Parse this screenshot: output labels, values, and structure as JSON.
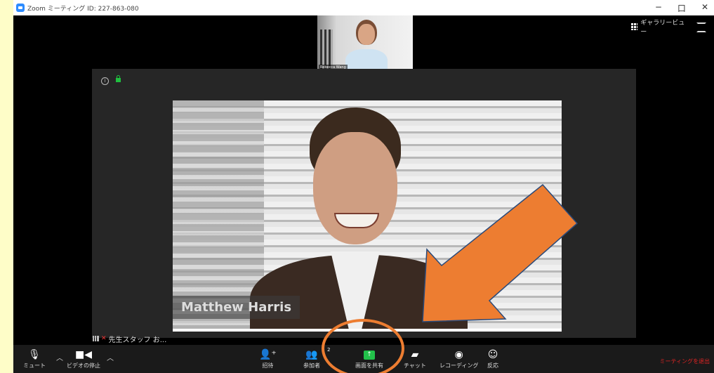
{
  "window": {
    "title": "Zoom ミーティング ID: 227-863-080"
  },
  "title_controls": {
    "minimize": "−",
    "maximize": "口",
    "close": "✕"
  },
  "view": {
    "gallery_label": "ギャラリービュー"
  },
  "thumbnail": {
    "name": "Rebecca Wang"
  },
  "speaker": {
    "name": "Matthew Harris"
  },
  "status": {
    "text": "先生スタッフ お..."
  },
  "toolbar": {
    "mute": "ミュート",
    "video": "ビデオの停止",
    "invite": "招待",
    "participants": "参加者",
    "participants_count": "2",
    "share": "画面を共有",
    "chat": "チャット",
    "record": "レコーディング",
    "reactions": "反応",
    "leave": "ミーティングを退出"
  },
  "colors": {
    "share_green": "#22c14a",
    "leave_red": "#e02424",
    "annotation_orange": "#ed7d31"
  }
}
